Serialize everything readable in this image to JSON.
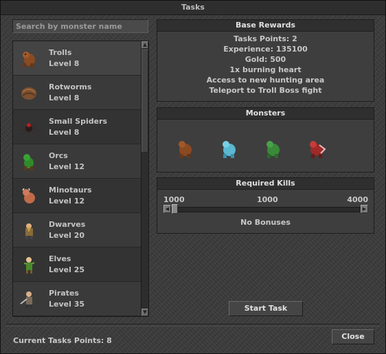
{
  "window": {
    "title": "Tasks"
  },
  "search": {
    "placeholder": "Search by monster name"
  },
  "monster_list": [
    {
      "name": "Trolls",
      "level": "Level 8",
      "icon": "troll-icon"
    },
    {
      "name": "Rotworms",
      "level": "Level 8",
      "icon": "rotworm-icon"
    },
    {
      "name": "Small Spiders",
      "level": "Level 8",
      "icon": "spider-icon"
    },
    {
      "name": "Orcs",
      "level": "Level 12",
      "icon": "orc-icon"
    },
    {
      "name": "Minotaurs",
      "level": "Level 12",
      "icon": "minotaur-icon"
    },
    {
      "name": "Dwarves",
      "level": "Level 20",
      "icon": "dwarf-icon"
    },
    {
      "name": "Elves",
      "level": "Level 25",
      "icon": "elf-icon"
    },
    {
      "name": "Pirates",
      "level": "Level 35",
      "icon": "pirate-icon"
    }
  ],
  "base_rewards": {
    "title": "Base Rewards",
    "lines": [
      "Tasks Points: 2",
      "Experience: 135100",
      "Gold: 500",
      "1x burning heart",
      "Access to new hunting area",
      "Teleport to Troll Boss fight"
    ]
  },
  "monsters": {
    "title": "Monsters",
    "icons": [
      "troll-icon",
      "frost-troll-icon",
      "swamp-troll-icon",
      "troll-champion-icon"
    ]
  },
  "required_kills": {
    "title": "Required Kills",
    "min": "1000",
    "current": "1000",
    "max": "4000",
    "value": 1000,
    "bonus_text": "No Bonuses"
  },
  "buttons": {
    "start_task": "Start Task",
    "close": "Close"
  },
  "footer": {
    "current_points": "Current Tasks Points: 8"
  },
  "colors": {
    "window_bg": "#3b3b3b",
    "text": "#c0c0c0",
    "header_text": "#e0e0e0"
  }
}
